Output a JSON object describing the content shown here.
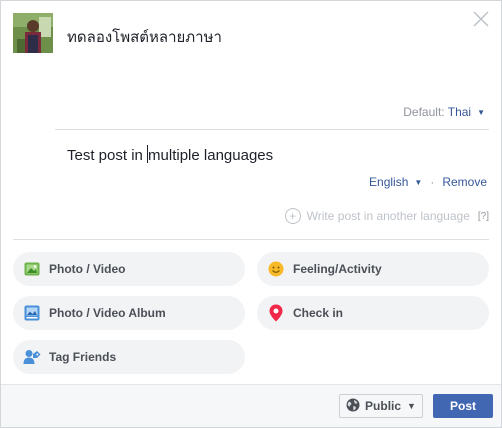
{
  "header": {
    "post_text_primary": "ทดลองโพสต์หลายภาษา"
  },
  "default_language": {
    "prefix": "Default: ",
    "language": "Thai"
  },
  "translation": {
    "text_before_cursor": "Test post in ",
    "text_after_cursor": "multiple languages",
    "language": "English",
    "remove_label": "Remove"
  },
  "write_another": {
    "label": "Write post in another language",
    "help": "[?]"
  },
  "actions": {
    "photo_video": "Photo / Video",
    "feeling_activity": "Feeling/Activity",
    "photo_video_album": "Photo / Video Album",
    "check_in": "Check in",
    "tag_friends": "Tag Friends"
  },
  "footer": {
    "privacy_label": "Public",
    "post_label": "Post"
  },
  "colors": {
    "link": "#365899",
    "post_button": "#4267b2",
    "feeling_icon": "#f7b928",
    "checkin_icon": "#f02849",
    "photo_icon": "#6bb34a"
  },
  "icons": {
    "close": "close-icon",
    "photo": "photo-icon",
    "feeling": "smiley-icon",
    "album": "album-icon",
    "checkin": "location-pin-icon",
    "tag": "tag-friends-icon",
    "globe": "globe-icon",
    "plus": "plus-circle-icon"
  }
}
